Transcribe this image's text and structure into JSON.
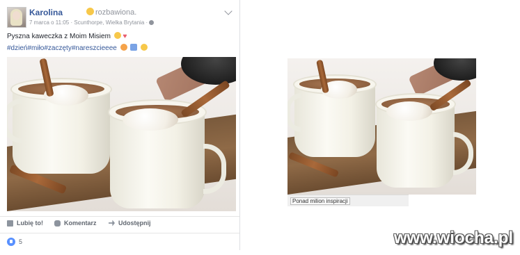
{
  "post": {
    "author": "Karolina",
    "feeling": "rozbawiona.",
    "meta": "7 marca o 11:05 · Scunthorpe, Wielka Brytania · ",
    "text": "Pyszna kaweczka z Moim Misiem",
    "tags": "#dzień#miło#zaczęty#nareszcieeee",
    "actions": {
      "like": "Lubię to!",
      "comment": "Komentarz",
      "share": "Udostępnij"
    },
    "like_count": "5"
  },
  "right_image": {
    "caption": "Ponad milion inspiracji"
  },
  "watermark": "www.wiocha.pl",
  "colors": {
    "fb_link": "#365899",
    "like_blue": "#5890ff",
    "heart": "#e85a6a"
  }
}
